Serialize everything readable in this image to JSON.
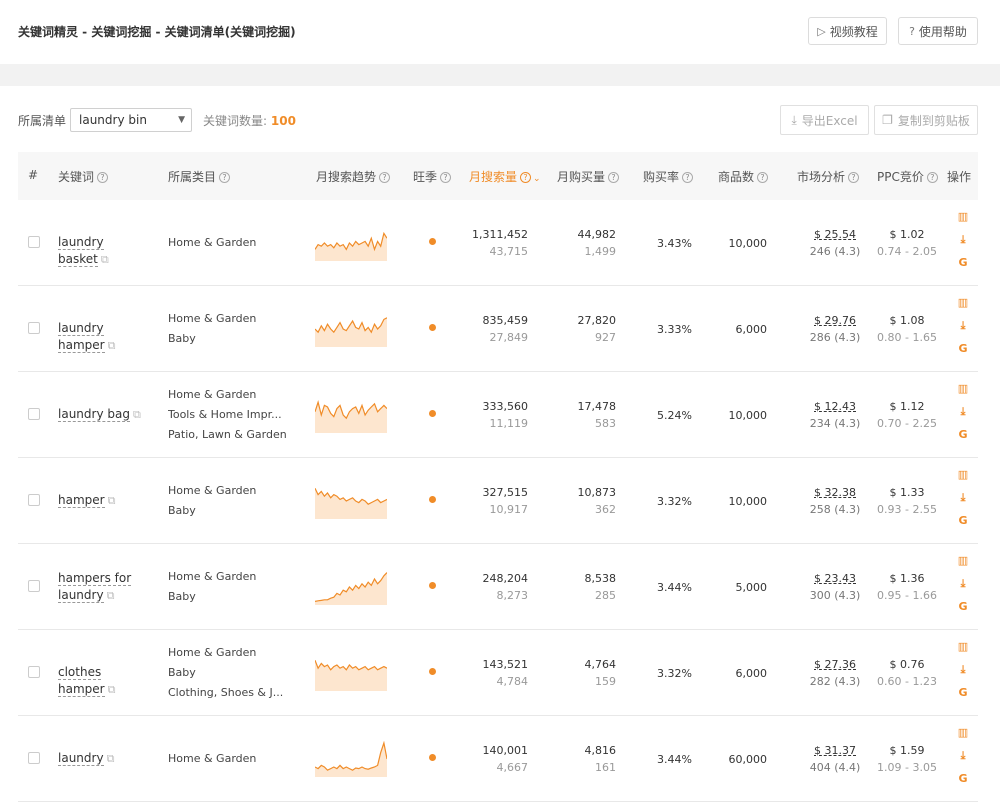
{
  "header": {
    "breadcrumb": "关键词精灵 - 关键词挖掘 - 关键词清单(关键词挖掘)",
    "btn_video": "视频教程",
    "btn_help": "使用帮助"
  },
  "toolbar": {
    "list_label": "所属清单",
    "list_value": "laundry bin",
    "count_label": "关键词数量:",
    "count_value": "100",
    "export_label": "导出Excel",
    "copy_label": "复制到剪贴板"
  },
  "columns": {
    "index": "#",
    "keyword": "关键词",
    "category": "所属类目",
    "trend": "月搜索趋势",
    "season": "旺季",
    "monthly_search": "月搜索量",
    "monthly_purchase": "月购买量",
    "conversion": "购买率",
    "products": "商品数",
    "market": "市场分析",
    "ppc": "PPC竞价",
    "actions": "操作"
  },
  "rows": [
    {
      "keyword": "laundry basket",
      "categories": [
        "Home & Garden"
      ],
      "search": "1,311,452",
      "search_sub": "43,715",
      "purchase": "44,982",
      "purchase_sub": "1,499",
      "rate": "3.43%",
      "products": "10,000",
      "price": "$ 25.54",
      "reviews": "246 (4.3)",
      "ppc": "$ 1.02",
      "ppc_range": "0.74 - 2.05",
      "trend": [
        0.7,
        0.55,
        0.6,
        0.5,
        0.6,
        0.55,
        0.65,
        0.5,
        0.6,
        0.55,
        0.7,
        0.5,
        0.6,
        0.45,
        0.55,
        0.5,
        0.45,
        0.6,
        0.35,
        0.7,
        0.45,
        0.6,
        0.2,
        0.35
      ]
    },
    {
      "keyword": "laundry hamper",
      "categories": [
        "Home & Garden",
        "Baby"
      ],
      "search": "835,459",
      "search_sub": "27,849",
      "purchase": "27,820",
      "purchase_sub": "927",
      "rate": "3.33%",
      "products": "6,000",
      "price": "$ 29.76",
      "reviews": "286 (4.3)",
      "ppc": "$ 1.08",
      "ppc_range": "0.80 - 1.65",
      "trend": [
        0.5,
        0.6,
        0.4,
        0.55,
        0.35,
        0.5,
        0.6,
        0.45,
        0.3,
        0.5,
        0.55,
        0.4,
        0.25,
        0.45,
        0.5,
        0.3,
        0.55,
        0.45,
        0.6,
        0.35,
        0.5,
        0.4,
        0.2,
        0.15
      ]
    },
    {
      "keyword": "laundry bag",
      "categories": [
        "Home & Garden",
        "Tools & Home Impr...",
        "Patio, Lawn & Garden"
      ],
      "search": "333,560",
      "search_sub": "11,119",
      "purchase": "17,478",
      "purchase_sub": "583",
      "rate": "5.24%",
      "products": "10,000",
      "price": "$ 12.43",
      "reviews": "234 (4.3)",
      "ppc": "$ 1.12",
      "ppc_range": "0.70 - 2.25",
      "trend": [
        0.4,
        0.1,
        0.5,
        0.2,
        0.25,
        0.45,
        0.55,
        0.3,
        0.2,
        0.5,
        0.6,
        0.4,
        0.3,
        0.25,
        0.45,
        0.2,
        0.5,
        0.35,
        0.25,
        0.15,
        0.4,
        0.3,
        0.2,
        0.3
      ]
    },
    {
      "keyword": "hamper",
      "categories": [
        "Home & Garden",
        "Baby"
      ],
      "search": "327,515",
      "search_sub": "10,917",
      "purchase": "10,873",
      "purchase_sub": "362",
      "rate": "3.32%",
      "products": "10,000",
      "price": "$ 32.38",
      "reviews": "258 (4.3)",
      "ppc": "$ 1.33",
      "ppc_range": "0.93 - 2.55",
      "trend": [
        0.1,
        0.3,
        0.2,
        0.35,
        0.25,
        0.4,
        0.3,
        0.35,
        0.45,
        0.4,
        0.5,
        0.45,
        0.4,
        0.5,
        0.55,
        0.45,
        0.5,
        0.6,
        0.55,
        0.5,
        0.45,
        0.55,
        0.5,
        0.45
      ]
    },
    {
      "keyword": "hampers for laundry",
      "categories": [
        "Home & Garden",
        "Baby"
      ],
      "search": "248,204",
      "search_sub": "8,273",
      "purchase": "8,538",
      "purchase_sub": "285",
      "rate": "3.44%",
      "products": "5,000",
      "price": "$ 23.43",
      "reviews": "300 (4.3)",
      "ppc": "$ 1.36",
      "ppc_range": "0.95 - 1.66",
      "trend": [
        0.95,
        0.93,
        0.92,
        0.9,
        0.9,
        0.85,
        0.82,
        0.7,
        0.75,
        0.6,
        0.65,
        0.5,
        0.6,
        0.45,
        0.55,
        0.4,
        0.5,
        0.35,
        0.45,
        0.25,
        0.4,
        0.3,
        0.15,
        0.05
      ]
    },
    {
      "keyword": "clothes hamper",
      "categories": [
        "Home & Garden",
        "Baby",
        "Clothing, Shoes & J..."
      ],
      "search": "143,521",
      "search_sub": "4,784",
      "purchase": "4,764",
      "purchase_sub": "159",
      "rate": "3.32%",
      "products": "6,000",
      "price": "$ 27.36",
      "reviews": "282 (4.3)",
      "ppc": "$ 0.76",
      "ppc_range": "0.60 - 1.23",
      "trend": [
        0.1,
        0.35,
        0.2,
        0.3,
        0.25,
        0.4,
        0.3,
        0.25,
        0.35,
        0.3,
        0.4,
        0.25,
        0.35,
        0.3,
        0.4,
        0.35,
        0.3,
        0.4,
        0.35,
        0.3,
        0.4,
        0.35,
        0.3,
        0.35
      ]
    },
    {
      "keyword": "laundry",
      "categories": [
        "Home & Garden"
      ],
      "search": "140,001",
      "search_sub": "4,667",
      "purchase": "4,816",
      "purchase_sub": "161",
      "rate": "3.44%",
      "products": "60,000",
      "price": "$ 31.37",
      "reviews": "404 (4.4)",
      "ppc": "$ 1.59",
      "ppc_range": "1.09 - 3.05",
      "trend": [
        0.75,
        0.8,
        0.7,
        0.75,
        0.85,
        0.8,
        0.75,
        0.8,
        0.7,
        0.8,
        0.75,
        0.8,
        0.85,
        0.78,
        0.8,
        0.75,
        0.8,
        0.82,
        0.78,
        0.75,
        0.7,
        0.3,
        0.0,
        0.5
      ]
    }
  ],
  "colors": {
    "accent": "#f08c28",
    "spark_fill": "#fde6cf"
  },
  "icons": {
    "play": "play-circle-icon",
    "help": "question-circle-icon",
    "download": "download-icon",
    "copy": "copy-icon",
    "chart": "bar-chart-icon",
    "google": "google-icon"
  }
}
